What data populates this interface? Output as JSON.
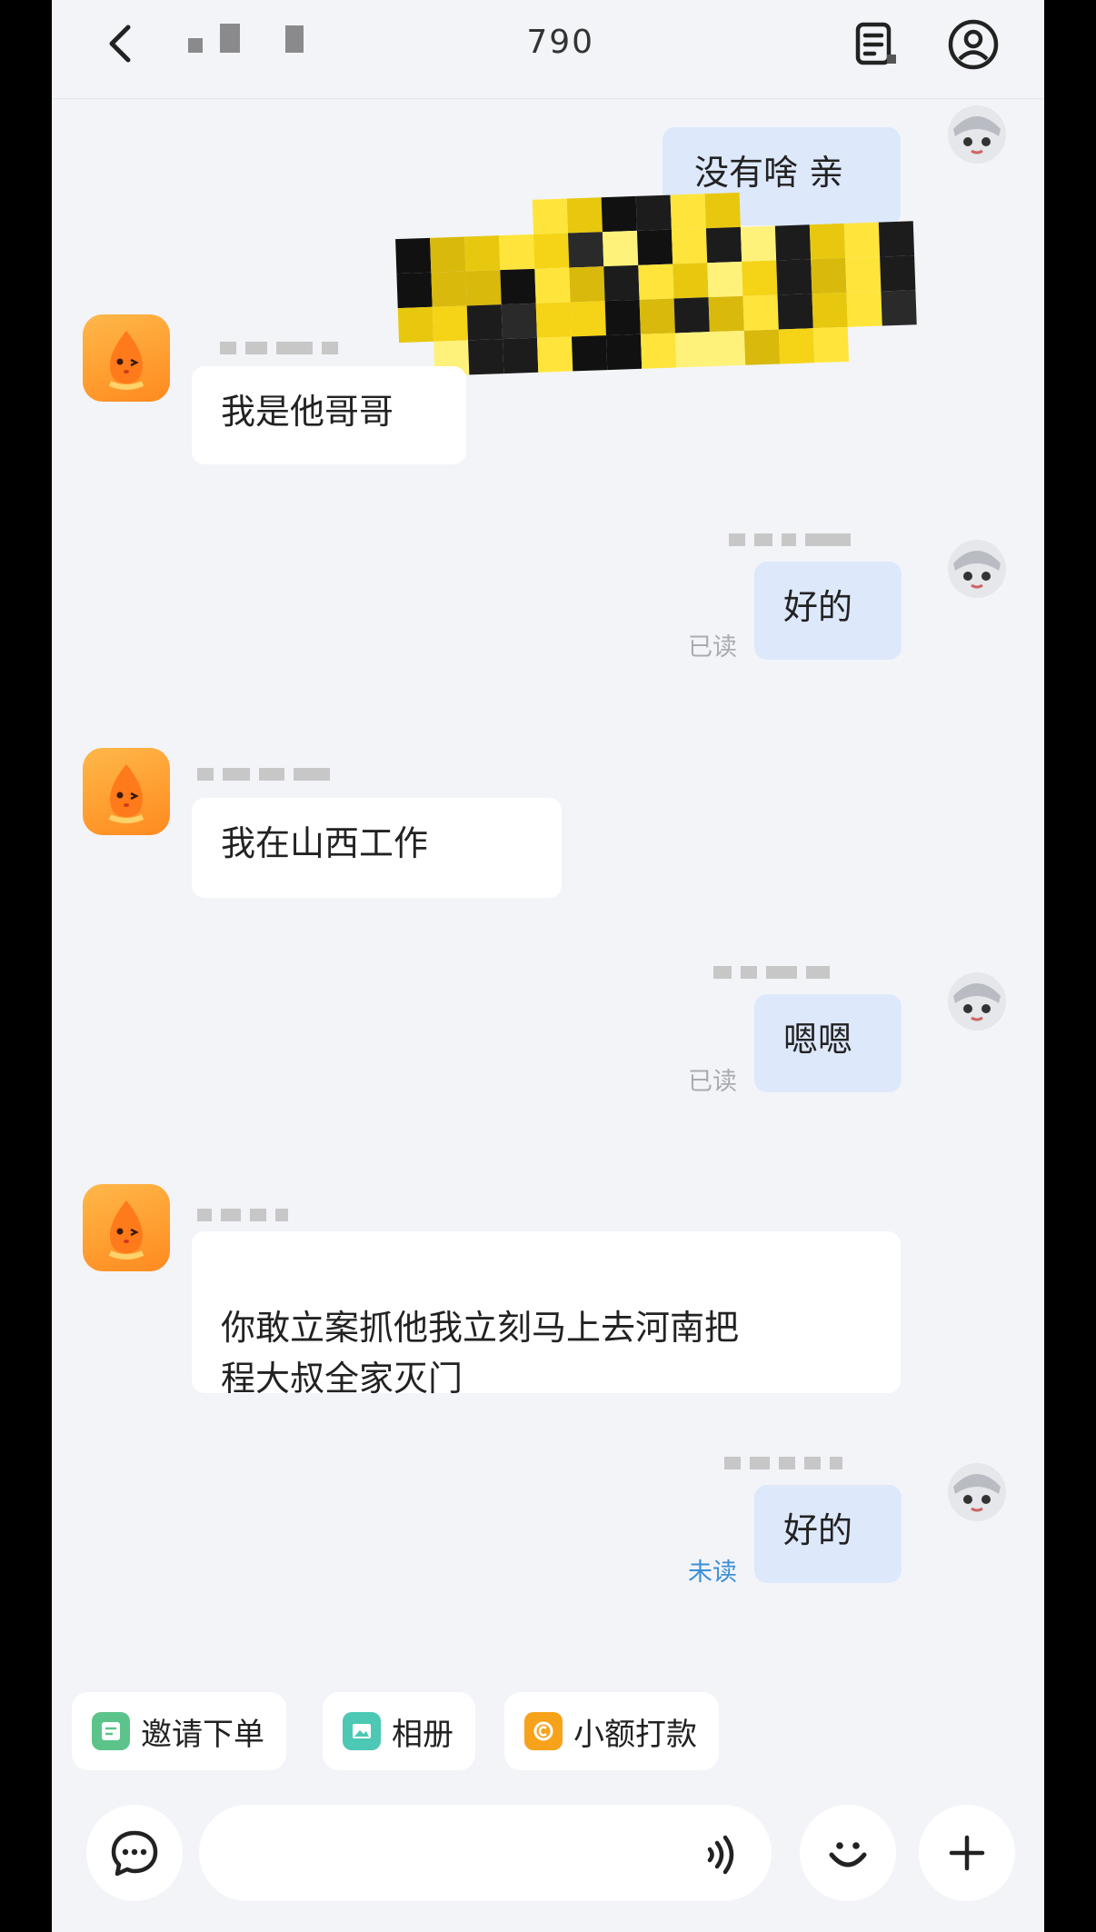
{
  "header": {
    "title": "      790",
    "back_icon": "chevron-left-icon",
    "list_icon": "order-list-icon",
    "profile_icon": "user-profile-icon"
  },
  "messages": [
    {
      "side": "right",
      "text": "没有啥 亲",
      "status": ""
    },
    {
      "side": "left",
      "text": "我是他哥哥"
    },
    {
      "side": "right",
      "text": "好的",
      "status": "已读"
    },
    {
      "side": "left",
      "text": "我在山西工作"
    },
    {
      "side": "right",
      "text": "嗯嗯",
      "status": "已读"
    },
    {
      "side": "left",
      "text": "你敢立案抓他我立刻马上去河南把\n程大叔全家灭门"
    },
    {
      "side": "right",
      "text": "好的",
      "status": "未读"
    }
  ],
  "quick_actions": [
    {
      "label": "邀请下单",
      "icon": "invite-order-icon",
      "color": "#5cc48a"
    },
    {
      "label": "相册",
      "icon": "photo-album-icon",
      "color": "#4cc8b4"
    },
    {
      "label": "小额打款",
      "icon": "small-payment-icon",
      "color": "#f7a21b"
    }
  ],
  "input": {
    "placeholder": "",
    "left_icon": "chat-bubble-icon",
    "voice_icon": "voice-icon",
    "emoji_icon": "emoji-icon",
    "plus_icon": "plus-icon"
  },
  "colors": {
    "background": "#f3f4f8",
    "bubble_right": "#dde8fb",
    "bubble_left": "#ffffff",
    "unread": "#3d8fd6",
    "read": "#a9abb0"
  }
}
